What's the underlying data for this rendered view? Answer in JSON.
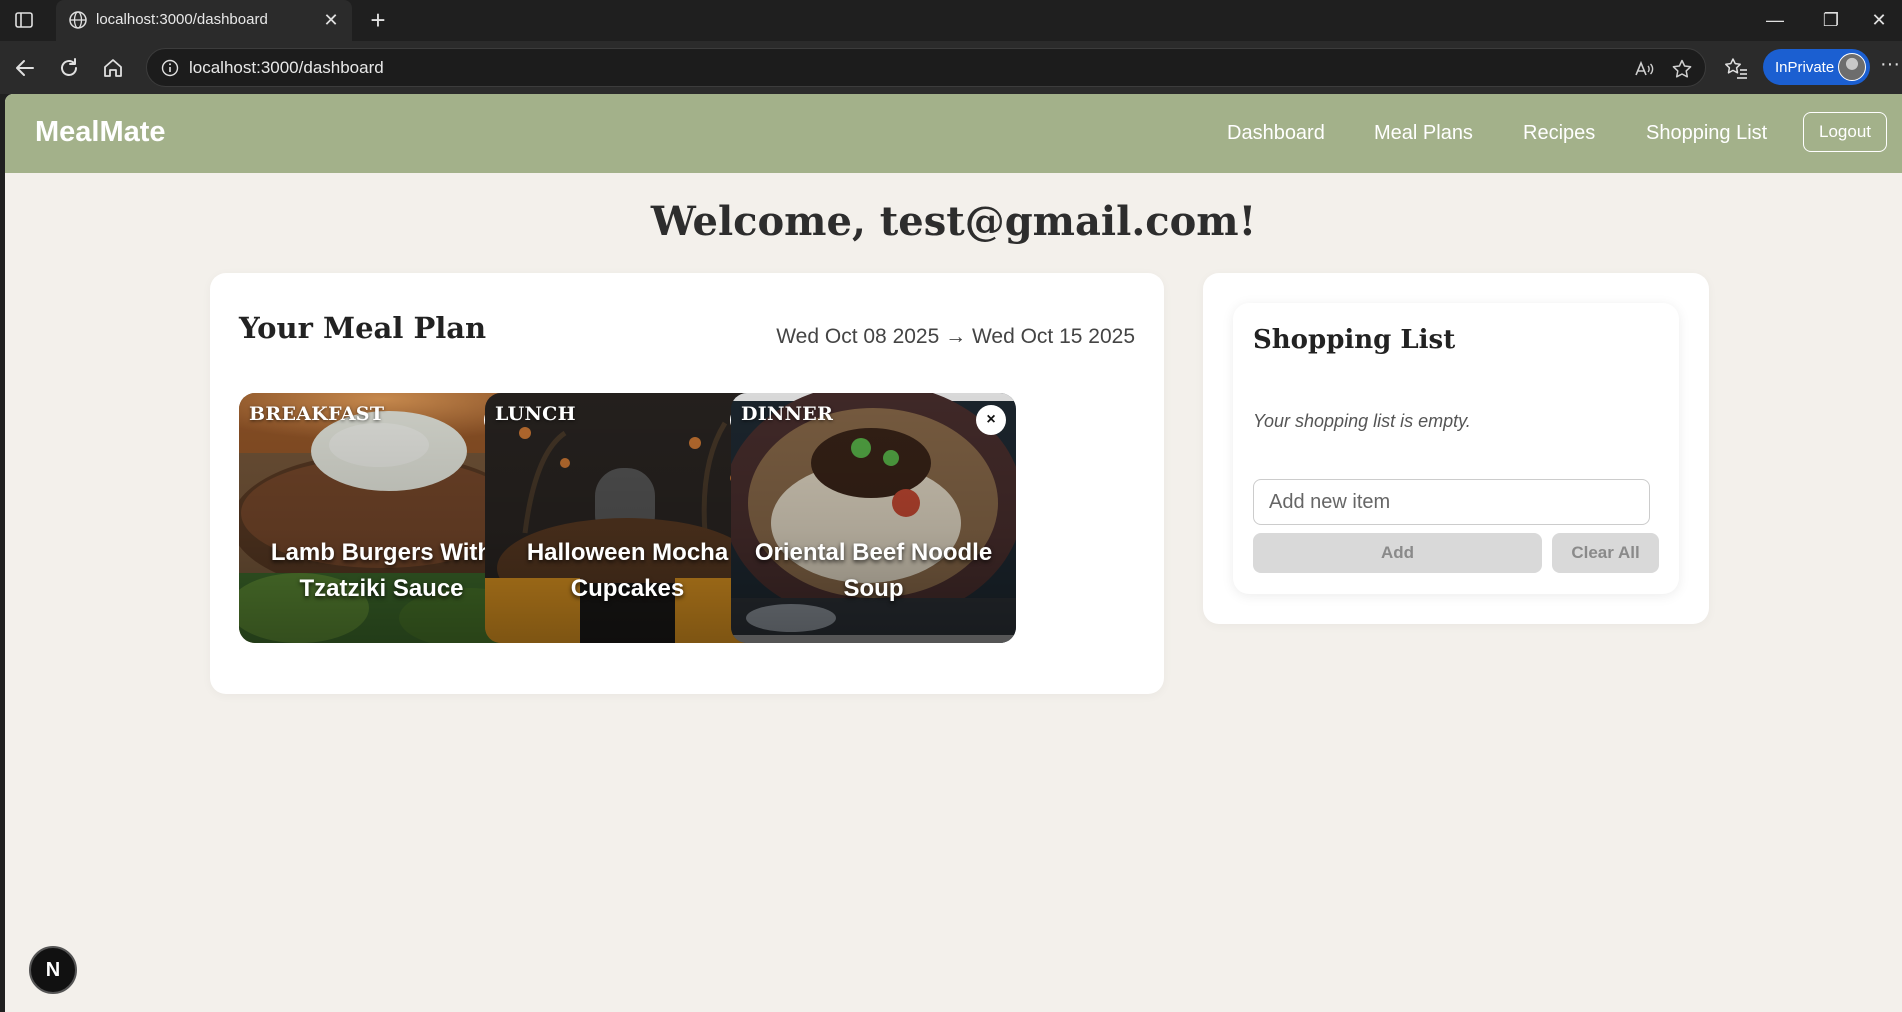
{
  "browser": {
    "tab_title": "localhost:3000/dashboard",
    "tab_close": "✕",
    "new_tab": "+",
    "url": "localhost:3000/dashboard",
    "inprivate_label": "InPrivate",
    "more": "···",
    "minimize": "—",
    "restore": "❐",
    "close": "✕"
  },
  "nav": {
    "brand": "MealMate",
    "links": [
      "Dashboard",
      "Meal Plans",
      "Recipes",
      "Shopping List"
    ],
    "logout": "Logout"
  },
  "welcome": "Welcome, test@gmail.com!",
  "meal_plan": {
    "title": "Your Meal Plan",
    "date_range": "Wed Oct 08 2025 → Wed Oct 15 2025",
    "remove_glyph": "×",
    "meals": [
      {
        "type": "BREAKFAST",
        "name": "Lamb Burgers With Tzatziki Sauce"
      },
      {
        "type": "LUNCH",
        "name": "Halloween Mocha Cupcakes"
      },
      {
        "type": "DINNER",
        "name": "Oriental Beef Noodle Soup"
      }
    ]
  },
  "shopping": {
    "title": "Shopping List",
    "empty_text": "Your shopping list is empty.",
    "input_placeholder": "Add new item",
    "add_label": "Add",
    "clear_label": "Clear All"
  },
  "dev_badge": "N"
}
